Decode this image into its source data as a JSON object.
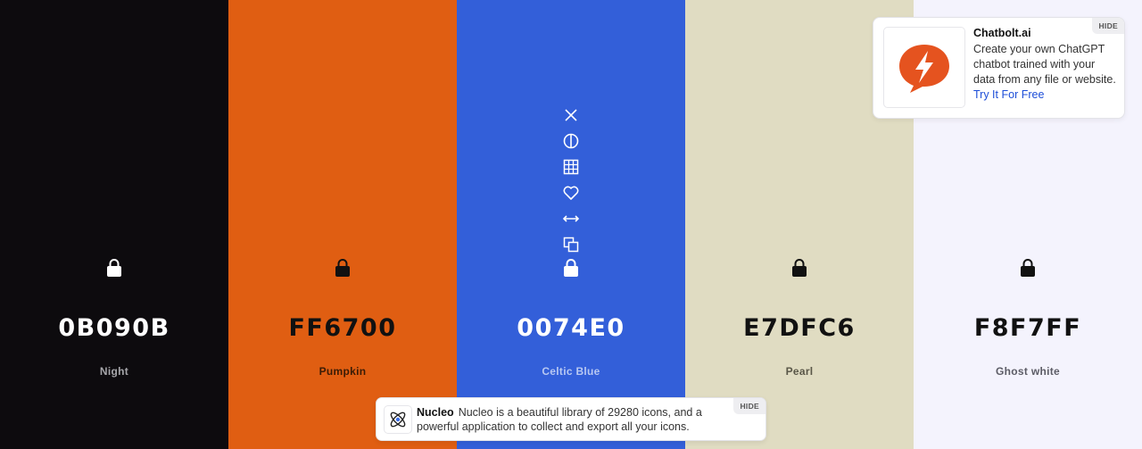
{
  "palette": {
    "colors": [
      {
        "hex": "0B090B",
        "name": "Night",
        "color": "#0d0b0e",
        "text_color": "#ffffff",
        "name_color": "#a6a6aa",
        "lock_color": "#ffffff"
      },
      {
        "hex": "FF6700",
        "name": "Pumpkin",
        "color": "#e05e12",
        "text_color": "#111111",
        "name_color": "#3a1c06",
        "lock_color": "#111111"
      },
      {
        "hex": "0074E0",
        "name": "Celtic Blue",
        "color": "#335fd9",
        "text_color": "#ffffff",
        "name_color": "#b8c8f2",
        "lock_color": "#ffffff"
      },
      {
        "hex": "E7DFC6",
        "name": "Pearl",
        "color": "#e0dcc2",
        "text_color": "#111111",
        "name_color": "#5a5748",
        "lock_color": "#111111"
      },
      {
        "hex": "F8F7FF",
        "name": "Ghost white",
        "color": "#f4f3fd",
        "text_color": "#111111",
        "name_color": "#5c5c66",
        "lock_color": "#111111"
      }
    ],
    "tool_icons": [
      "close-icon",
      "contrast-icon",
      "grid-icon",
      "heart-icon",
      "drag-arrows-icon",
      "copy-icon"
    ]
  },
  "ads": {
    "chatbolt": {
      "title": "Chatbolt.ai",
      "body": "Create your own ChatGPT chatbot trained with your data from any file or website.",
      "cta": "Try It For Free",
      "hide": "HIDE",
      "logo_color": "#e5531f"
    },
    "nucleo": {
      "title": "Nucleo",
      "body": "Nucleo is a beautiful library of 29280 icons, and a powerful application to collect and export all your icons.",
      "hide": "HIDE"
    }
  }
}
